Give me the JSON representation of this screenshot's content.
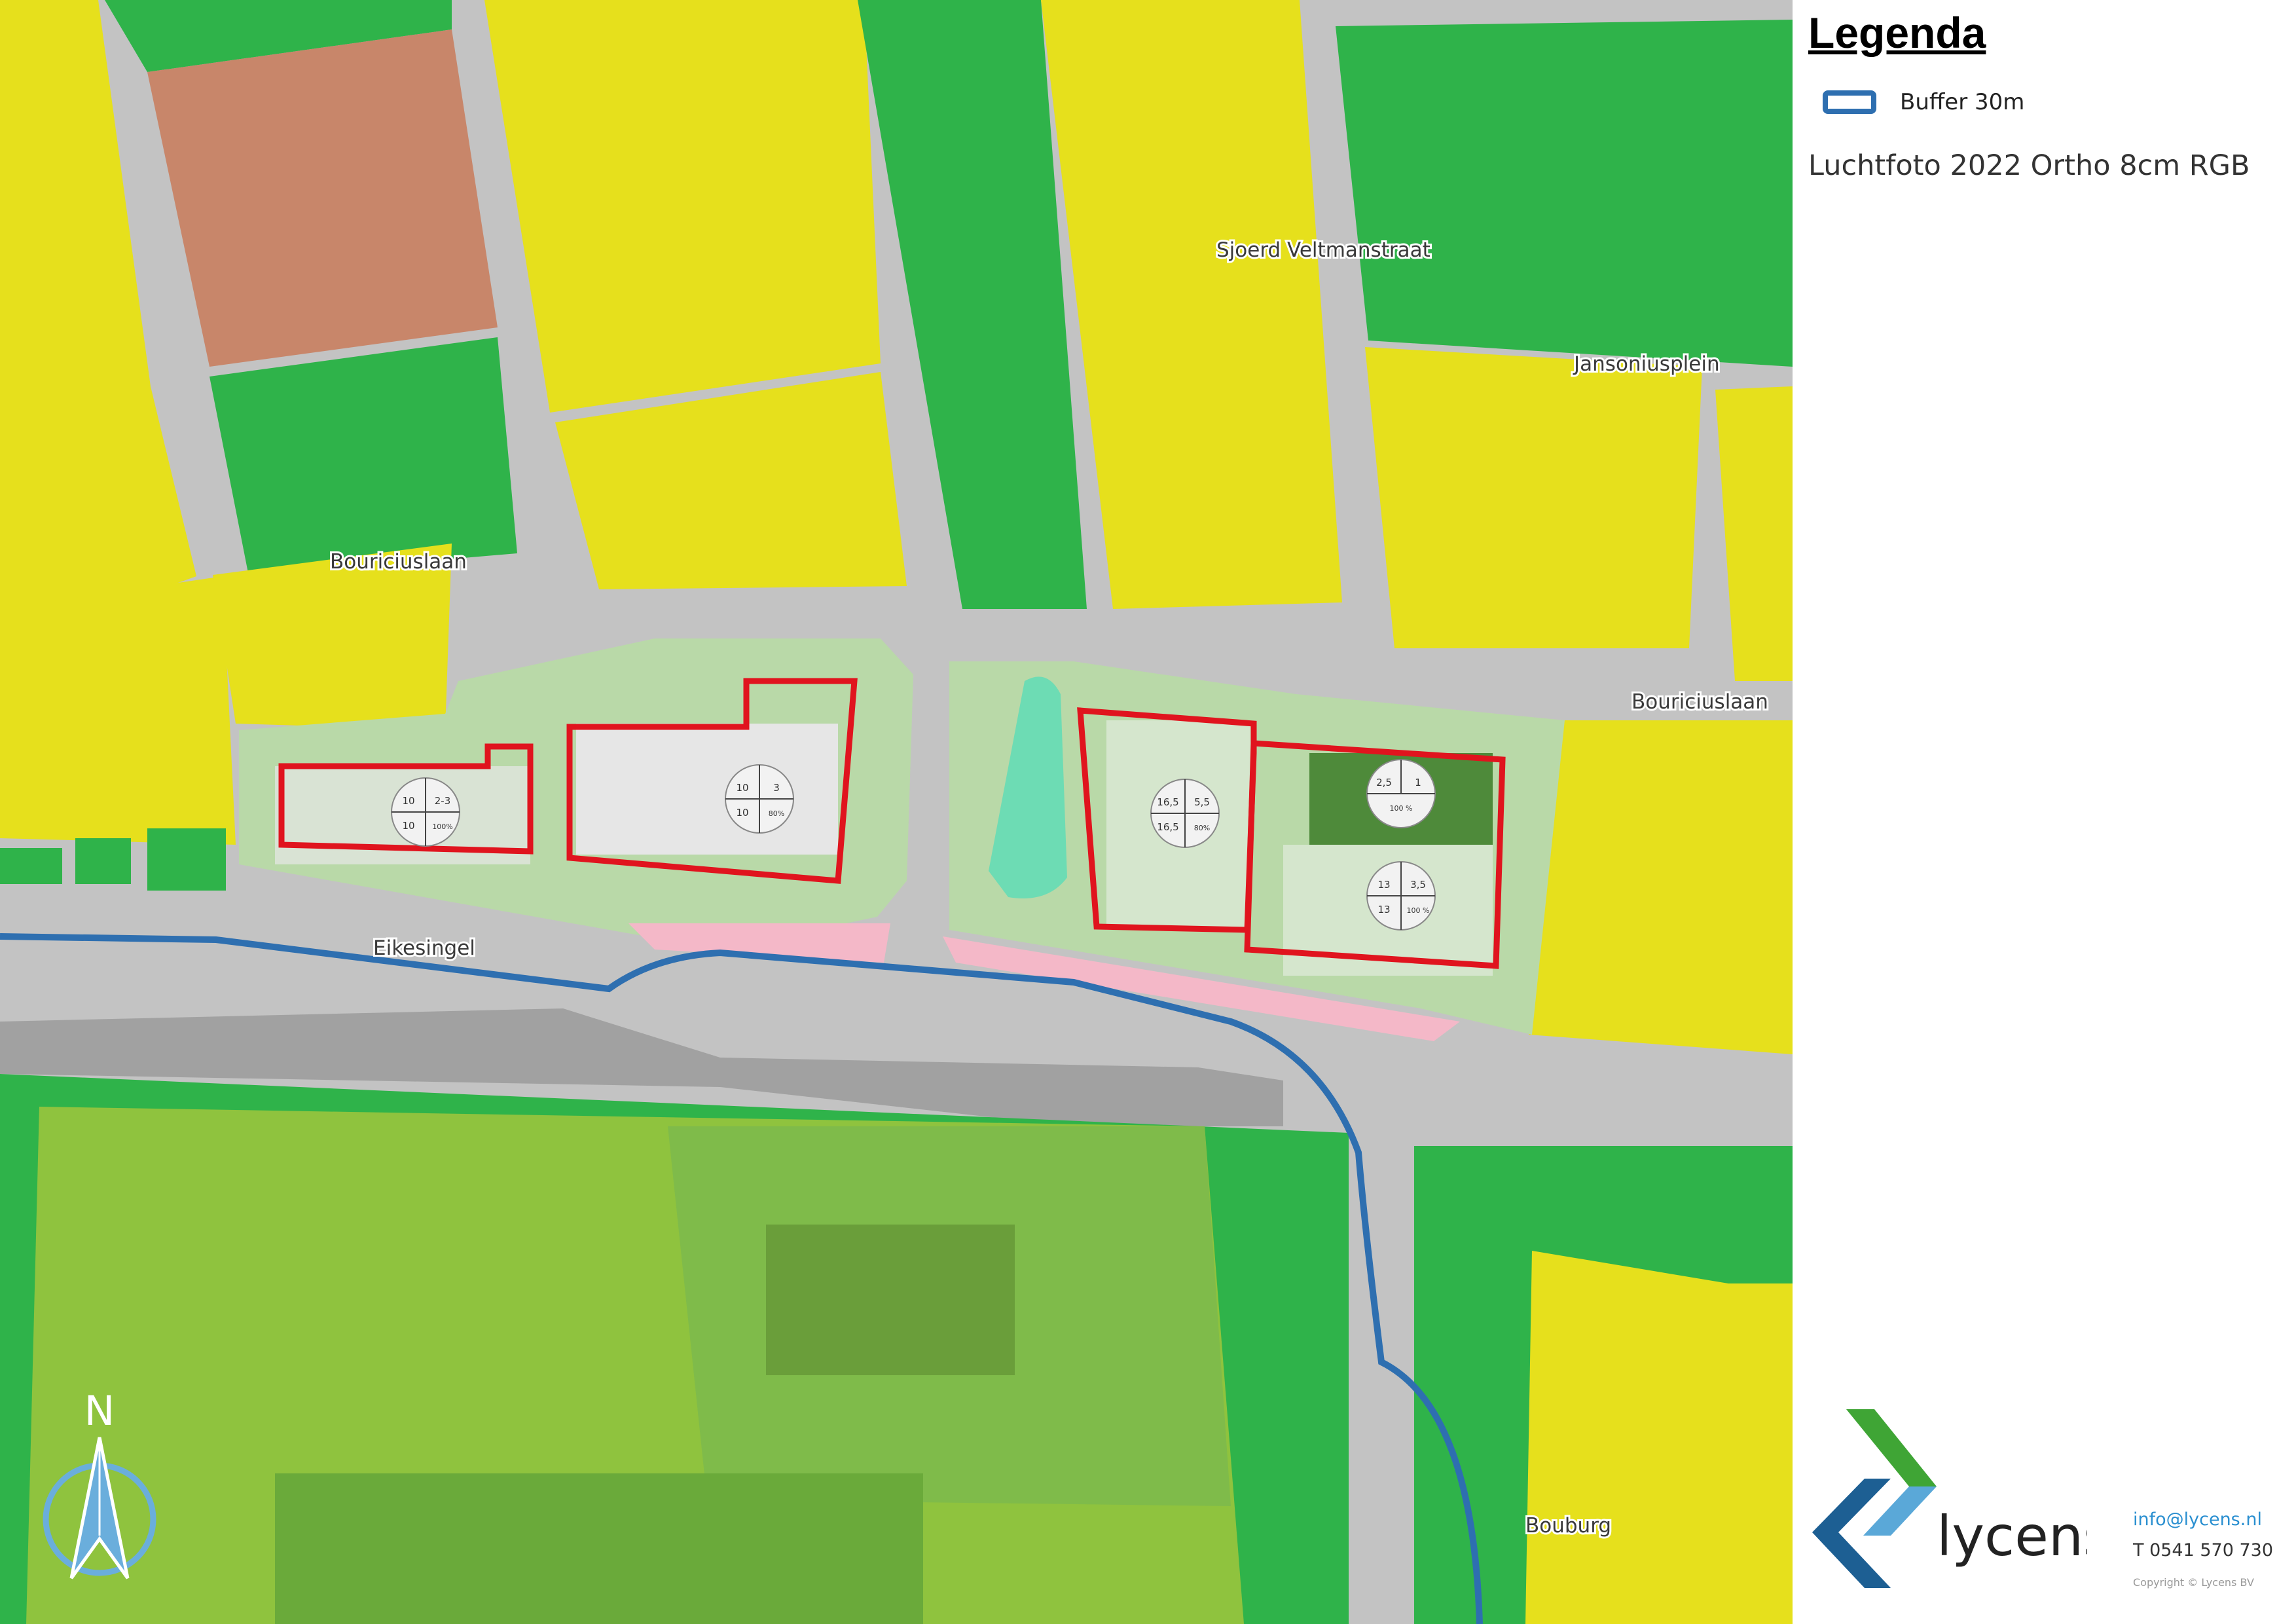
{
  "legend": {
    "title": "Legenda",
    "items": [
      {
        "label": "Buffer 30m",
        "swatch_color": "#2e6fb0"
      }
    ],
    "basemap": "Luchtfoto 2022 Ortho 8cm RGB"
  },
  "map": {
    "colors": {
      "residential": "#e6e01c",
      "green": "#2fb34a",
      "green_light": "#78c96a",
      "sport": "#8fc33e",
      "roads": "#c3c3c3",
      "school": "#c8866a",
      "buffer": "#2e6fb0",
      "plan_outline": "#e0141e",
      "plan_ground": "#b9d9a8",
      "pond": "#6ddcb4",
      "sidewalk": "#f4b8c8"
    },
    "street_labels": {
      "sjoerd_veltmanstraat": "Sjoerd Veltmanstraat",
      "jansoniusplein": "Jansoniusplein",
      "bouriciuslaan_west": "Bouriciuslaan",
      "bouriciuslaan_east": "Bouriciuslaan",
      "eikesingel": "Eikesingel",
      "bouburg": "Bouburg"
    },
    "north_label": "N",
    "plots": [
      {
        "tl": "10",
        "tr": "2-3",
        "bl": "10",
        "br": "100%"
      },
      {
        "tl": "10",
        "tr": "3",
        "bl": "10",
        "br": "80%"
      },
      {
        "tl": "16,5",
        "tr": "5,5",
        "bl": "16,5",
        "br": "80%"
      },
      {
        "tl": "2,5",
        "tr": "1",
        "bl": "",
        "br": "100 %"
      },
      {
        "tl": "13",
        "tr": "3,5",
        "bl": "13",
        "br": "100 %"
      }
    ]
  },
  "branding": {
    "name": "lycens",
    "email": "info@lycens.nl",
    "phone": "T 0541 570 730",
    "copyright": "Copyright © Lycens BV",
    "colors": {
      "green": "#3fa535",
      "blue": "#1d5f93",
      "light_blue": "#5aa8d8"
    }
  }
}
